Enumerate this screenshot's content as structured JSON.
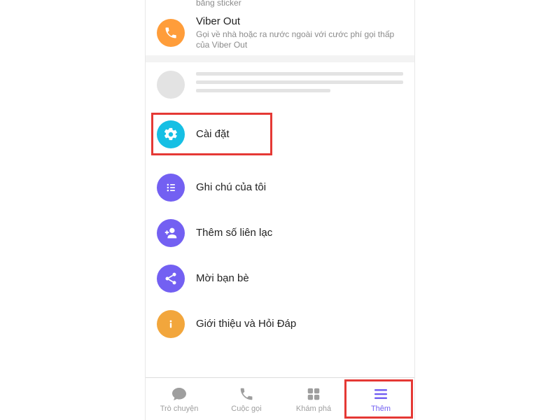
{
  "partial": {
    "sticker_trail": "bằng sticker"
  },
  "viber_out": {
    "title": "Viber Out",
    "subtitle": "Gọi về nhà hoặc ra nước ngoài với cước phí gọi thấp của Viber Out"
  },
  "menu": {
    "settings": {
      "label": "Cài đặt"
    },
    "notes": {
      "label": "Ghi chú của tôi"
    },
    "add_contact": {
      "label": "Thêm số liên lạc"
    },
    "invite": {
      "label": "Mời bạn bè"
    },
    "about": {
      "label": "Giới thiệu và Hỏi Đáp"
    }
  },
  "nav": {
    "chats": {
      "label": "Trò chuyện"
    },
    "calls": {
      "label": "Cuộc gọi"
    },
    "explore": {
      "label": "Khám phá"
    },
    "more": {
      "label": "Thêm"
    }
  }
}
